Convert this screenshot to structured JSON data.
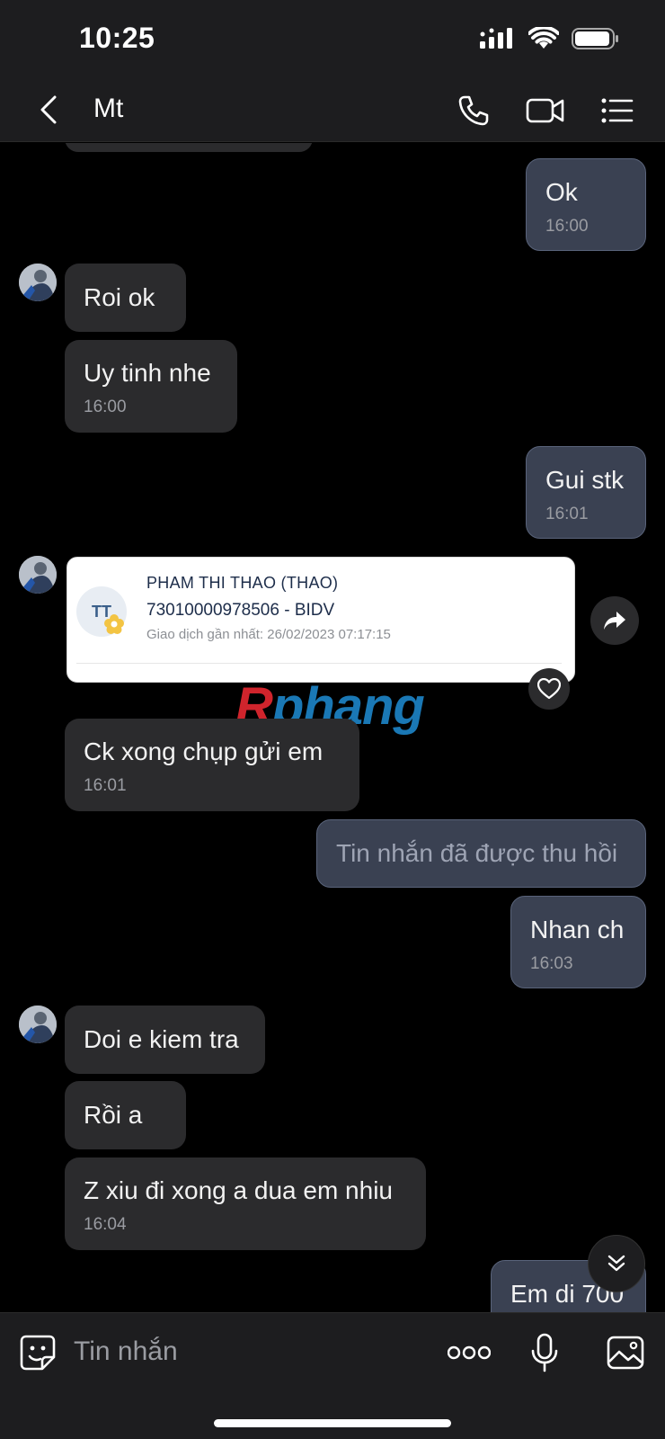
{
  "status_bar": {
    "time": "10:25"
  },
  "header": {
    "title": "Mt",
    "icons": [
      "back-arrow-icon",
      "phone-icon",
      "video-icon",
      "menu-list-icon"
    ]
  },
  "messages": [
    {
      "id": "m1",
      "direction": "out",
      "text": "Ok",
      "time": "16:00"
    },
    {
      "id": "m2",
      "direction": "in",
      "text": "Roi ok",
      "time": ""
    },
    {
      "id": "m3",
      "direction": "in",
      "text": "Uy tinh nhe",
      "time": "16:00"
    },
    {
      "id": "m4",
      "direction": "out",
      "text": "Gui stk",
      "time": "16:01"
    },
    {
      "id": "m6",
      "direction": "in",
      "text": "Ck xong chụp gửi em",
      "time": "16:01"
    },
    {
      "id": "m7",
      "direction": "out",
      "text": "Tin nhắn đã được thu hồi",
      "time": "",
      "recalled": true
    },
    {
      "id": "m8",
      "direction": "out",
      "text": "Nhan ch",
      "time": "16:03"
    },
    {
      "id": "m9",
      "direction": "in",
      "text": "Doi e kiem tra",
      "time": ""
    },
    {
      "id": "m10",
      "direction": "in",
      "text": "Rồi a",
      "time": ""
    },
    {
      "id": "m11",
      "direction": "in",
      "text": "Z xiu đi xong a dua em nhiu",
      "time": "16:04"
    },
    {
      "id": "m12",
      "direction": "out",
      "text": "Em di 700",
      "time": ""
    }
  ],
  "bank_card": {
    "initials": "TT",
    "name": "PHAM THI THAO (THAO)",
    "account": "73010000978506 - BIDV",
    "last_transaction": "Giao dịch gần nhất: 26/02/2023 07:17:15"
  },
  "watermark": {
    "first": "R",
    "rest": "phang"
  },
  "composer": {
    "placeholder": "Tin nhắn"
  },
  "colors": {
    "background": "#000000",
    "bar": "#1d1d1f",
    "incoming_bubble": "#2b2b2d",
    "outgoing_bubble": "#3a4152",
    "outgoing_border": "#59637a"
  }
}
